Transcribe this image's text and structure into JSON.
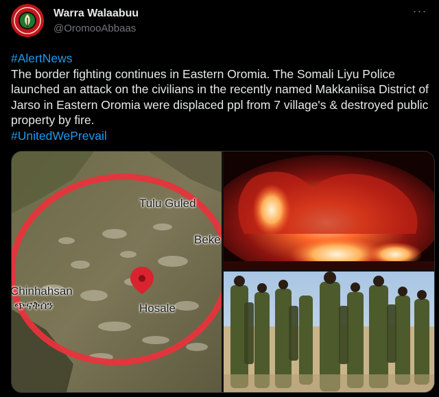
{
  "author": {
    "display_name": "Warra Walaabuu",
    "handle": "@OromooAbbaas",
    "avatar_icon": "oromo-emblem-avatar"
  },
  "more_icon": "more-options-icon",
  "tweet": {
    "hashtag_top": "#AlertNews",
    "body": "The border fighting continues in Eastern Oromia. The Somali Liyu Police launched an attack on the civilians in the recently named Makkaniisa District of Jarso in Eastern Oromia were displaced ppl from 7 village's & destroyed public property by fire.",
    "hashtag_bottom": "#UnitedWePrevail"
  },
  "map": {
    "labels": {
      "tulu_guled": "Tulu Guled",
      "beke": "Beke",
      "chinhahsan": "Chinhahsan",
      "chinhahsan_geez": "ጭናቅሰን",
      "hosale": "Hosale"
    },
    "pin_icon": "map-pin-icon",
    "pin_color": "#d9232e",
    "circle_color": "#e8333c"
  },
  "colors": {
    "accent": "#1d9bf0",
    "background": "#000000",
    "text": "#e7e9ea",
    "muted": "#71767b"
  }
}
